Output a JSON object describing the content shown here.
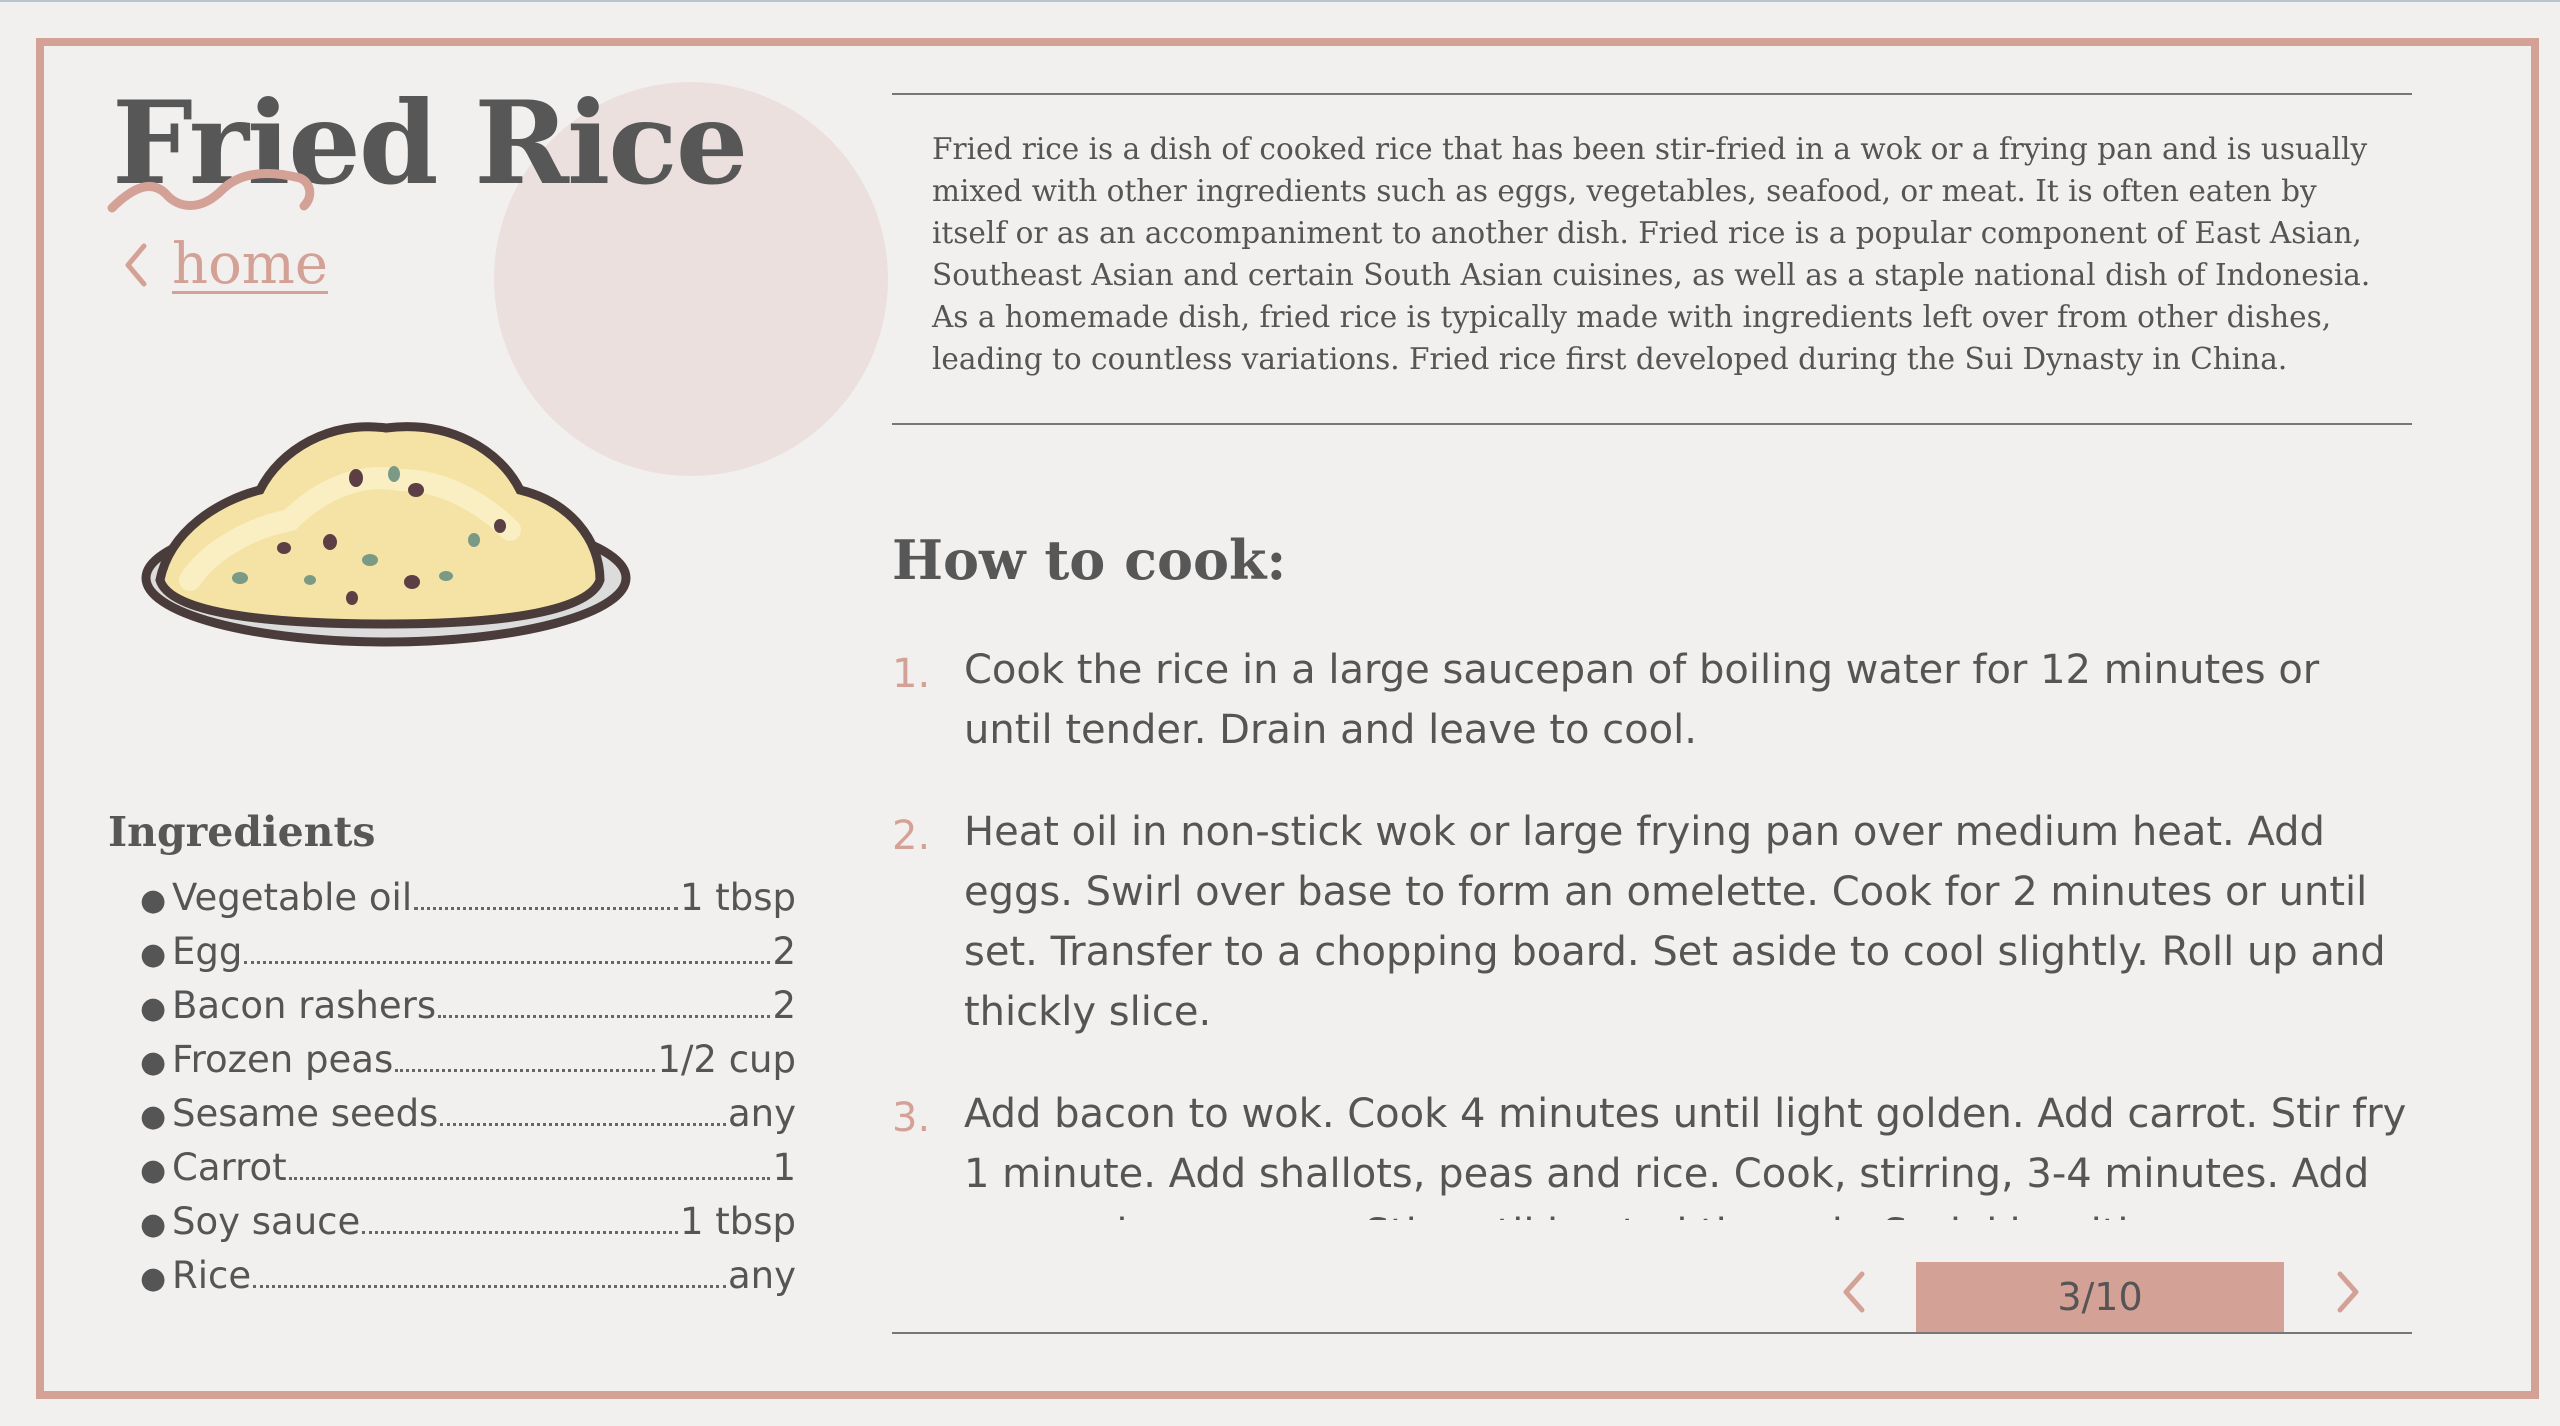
{
  "recipe": {
    "title": "Fried Rice",
    "home_label": "home",
    "description": "Fried rice is a dish of cooked rice that has been stir-fried in a wok or a frying pan and is usually mixed with other ingredients such as eggs, vegetables, seafood, or meat. It is often eaten by itself or as an accompaniment to another dish. Fried rice is a popular component of East Asian, Southeast Asian and certain South Asian cuisines, as well as a staple national dish of Indonesia. As a homemade dish, fried rice is typically made with ingredients left over from other dishes, leading to countless variations. Fried rice first developed during the Sui Dynasty in China."
  },
  "ingredients": {
    "title": "Ingredients",
    "items": [
      {
        "name": "Vegetable oil",
        "qty": "1 tbsp"
      },
      {
        "name": "Egg",
        "qty": "2"
      },
      {
        "name": "Bacon rashers",
        "qty": "2"
      },
      {
        "name": "Frozen peas",
        "qty": "1/2 cup"
      },
      {
        "name": "Sesame seeds",
        "qty": "any"
      },
      {
        "name": "Carrot",
        "qty": "1"
      },
      {
        "name": "Soy sauce",
        "qty": "1 tbsp"
      },
      {
        "name": "Rice",
        "qty": "any"
      }
    ]
  },
  "how_to": {
    "title": "How to cook:",
    "steps": [
      {
        "num": "1.",
        "text": "Cook the rice in a large saucepan of boiling water for 12 minutes or until tender. Drain and leave to cool."
      },
      {
        "num": "2.",
        "text": "Heat oil in non-stick wok or large frying pan over medium heat. Add eggs. Swirl over base to form an omelette. Cook for 2 minutes or until set. Transfer to a chopping board. Set aside to cool slightly. Roll up and thickly slice."
      },
      {
        "num": "3.",
        "text": "Add bacon to wok. Cook 4 minutes until light golden. Add carrot. Stir fry 1 minute. Add shallots, peas and rice. Cook, stirring, 3-4 minutes. Add egg and soy sauce. Stir until heated through. Sprinkle with sesame seeds and serve."
      }
    ]
  },
  "pager": {
    "label": "3/10"
  },
  "icons": {
    "back": "chevron-left-icon",
    "prev": "chevron-left-icon",
    "next": "chevron-right-icon",
    "dish": "fried-rice-plate-icon"
  },
  "colors": {
    "accent": "#d4a196",
    "background": "#f2f0ee",
    "text": "#555555",
    "circle": "#ebe0de"
  }
}
